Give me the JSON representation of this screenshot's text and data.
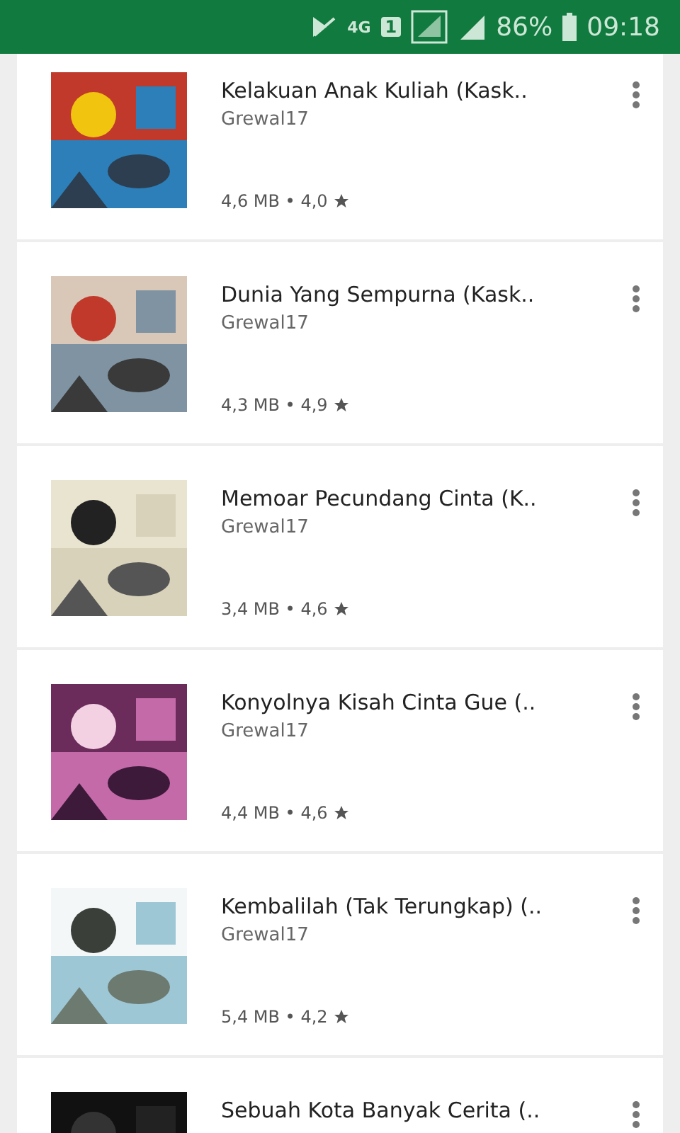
{
  "status_bar": {
    "network": "4G",
    "sim": "1",
    "battery": "86%",
    "time": "09:18"
  },
  "apps": [
    {
      "title": "Kelakuan Anak Kuliah (Kask..",
      "developer": "Grewal17",
      "meta": "4,6 MB • 4,0"
    },
    {
      "title": "Dunia Yang Sempurna (Kask..",
      "developer": "Grewal17",
      "meta": "4,3 MB • 4,9"
    },
    {
      "title": "Memoar Pecundang Cinta (K..",
      "developer": "Grewal17",
      "meta": "3,4 MB • 4,6"
    },
    {
      "title": "Konyolnya Kisah Cinta Gue (..",
      "developer": "Grewal17",
      "meta": "4,4 MB • 4,6"
    },
    {
      "title": "Kembalilah (Tak Terungkap) (..",
      "developer": "Grewal17",
      "meta": "5,4 MB • 4,2"
    },
    {
      "title": "Sebuah Kota Banyak Cerita (.."
    }
  ]
}
